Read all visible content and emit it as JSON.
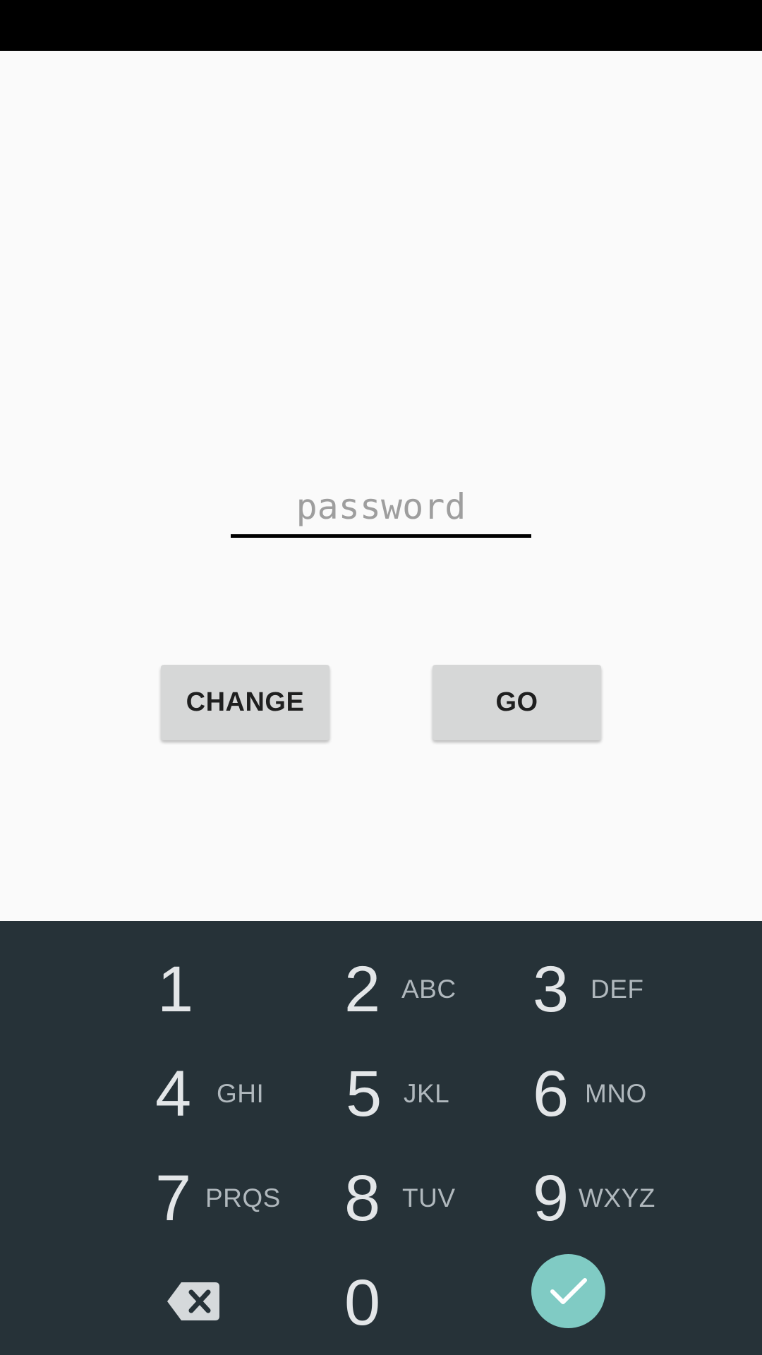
{
  "form": {
    "password_placeholder": "password",
    "password_value": "",
    "change_label": "CHANGE",
    "go_label": "GO"
  },
  "keypad": {
    "keys": [
      {
        "digit": "1",
        "letters": ""
      },
      {
        "digit": "2",
        "letters": "ABC"
      },
      {
        "digit": "3",
        "letters": "DEF"
      },
      {
        "digit": "4",
        "letters": "GHI"
      },
      {
        "digit": "5",
        "letters": "JKL"
      },
      {
        "digit": "6",
        "letters": "MNO"
      },
      {
        "digit": "7",
        "letters": "PRQS"
      },
      {
        "digit": "8",
        "letters": "TUV"
      },
      {
        "digit": "9",
        "letters": "WXYZ"
      },
      {
        "digit": "0",
        "letters": ""
      }
    ],
    "backspace_icon": "backspace-icon",
    "done_icon": "check-icon"
  },
  "colors": {
    "keypad_background": "#263238",
    "done_accent": "#80cbc4",
    "button_background": "#d6d7d7"
  }
}
